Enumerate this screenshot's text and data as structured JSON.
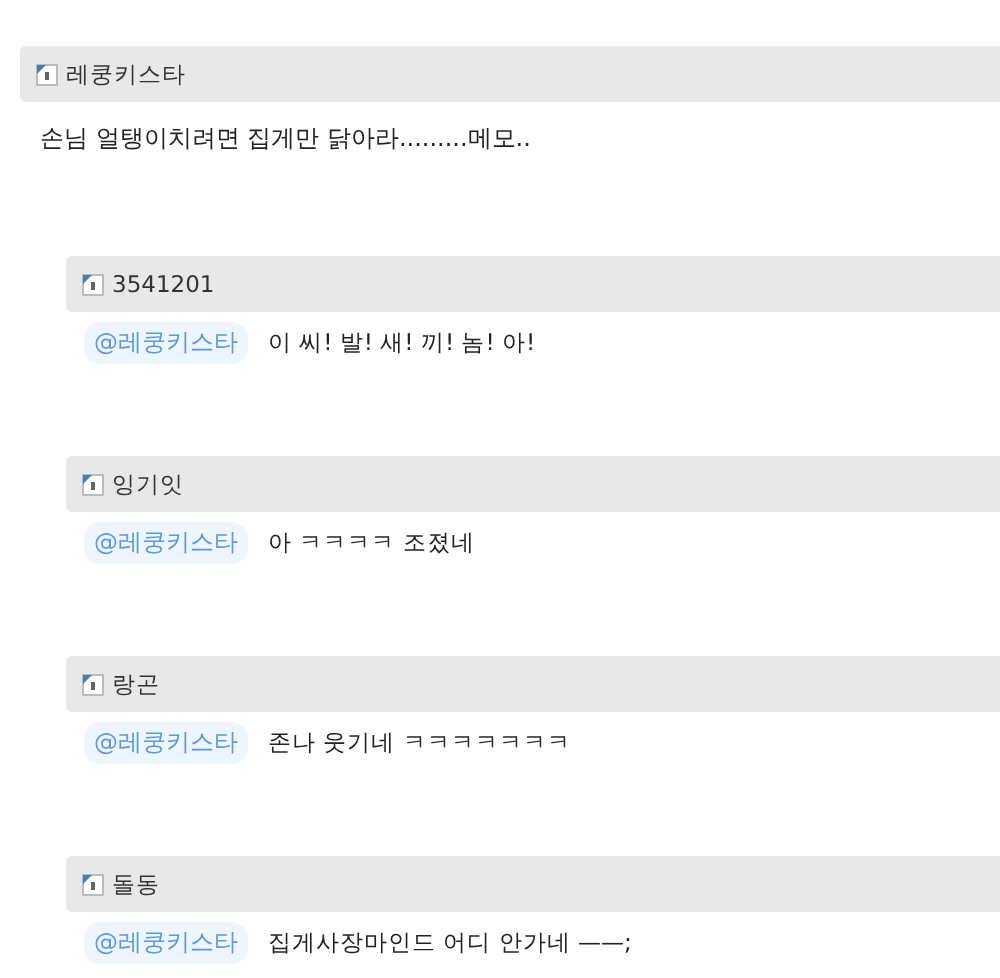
{
  "post": {
    "author": "레쿵키스타",
    "text": "손님 얼탱이치려면 집게만 닭아라.........메모.."
  },
  "replies": [
    {
      "author": "3541201",
      "mention": "@레쿵키스타",
      "text": "이 씨! 발! 새! 끼! 놈! 아!"
    },
    {
      "author": "잉기잇",
      "mention": "@레쿵키스타",
      "text": "아 ㅋㅋㅋㅋ 조졌네"
    },
    {
      "author": "랑곤",
      "mention": "@레쿵키스타",
      "text": "존나 웃기네 ㅋㅋㅋㅋㅋㅋㅋ"
    },
    {
      "author": "돌동",
      "mention": "@레쿵키스타",
      "text": "집게사장마인드 어디 안가네 ——;"
    }
  ]
}
